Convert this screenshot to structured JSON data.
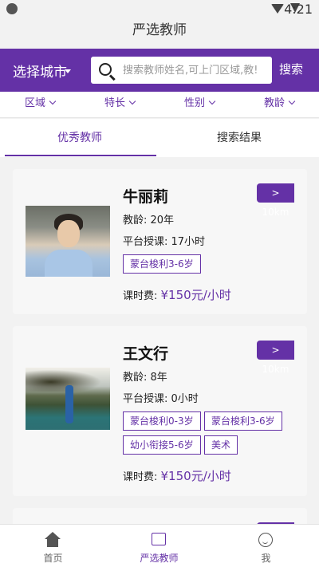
{
  "status": {
    "time": "4:21"
  },
  "title": "严选教师",
  "search": {
    "city_label": "选择城市",
    "placeholder": "搜索教师姓名,可上门区域,教!",
    "button_label": "搜索"
  },
  "filters": [
    "区域",
    "特长",
    "性别",
    "教龄"
  ],
  "tabs": [
    {
      "label": "优秀教师",
      "active": true
    },
    {
      "label": "搜索结果",
      "active": false
    }
  ],
  "teachers": [
    {
      "name": "牛丽莉",
      "distance": "> 10km",
      "experience": "教龄: 20年",
      "hours": "平台授课: 17小时",
      "tags": [
        "蒙台梭利3-6岁"
      ],
      "fee_label": "课时费: ",
      "fee_value": "¥150元/小时"
    },
    {
      "name": "王文行",
      "distance": "> 10km",
      "experience": "教龄: 8年",
      "hours": "平台授课: 0小时",
      "tags": [
        "蒙台梭利0-3岁",
        "蒙台梭利3-6岁",
        "幼小衔接5-6岁",
        "美术"
      ],
      "fee_label": "课时费: ",
      "fee_value": "¥150元/小时"
    }
  ],
  "nav": [
    {
      "label": "首页",
      "icon": "home-icon"
    },
    {
      "label": "严选教师",
      "icon": "teacher-icon",
      "active": true
    },
    {
      "label": "我",
      "icon": "smile-icon"
    }
  ],
  "colors": {
    "accent": "#6431a6",
    "background": "#f2f2f2",
    "card": "#f7f7f7"
  }
}
